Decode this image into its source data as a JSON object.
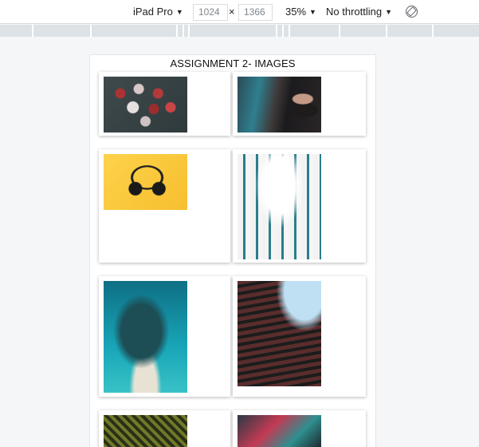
{
  "devtools": {
    "device": "iPad Pro",
    "width": "1024",
    "height": "1366",
    "separator": "×",
    "zoom": "35%",
    "throttling": "No throttling",
    "caret": "▼"
  },
  "page": {
    "title": "ASSIGNMENT 2- IMAGES"
  },
  "images": [
    {
      "name": "cupcakes-image"
    },
    {
      "name": "graffiti-image"
    },
    {
      "name": "headphones-image"
    },
    {
      "name": "building-image"
    },
    {
      "name": "reef-image"
    },
    {
      "name": "facade-image"
    },
    {
      "name": "palm-image"
    },
    {
      "name": "neon-image"
    }
  ],
  "colors": {
    "toolbar_bg": "#ffffff",
    "media_bar": "#dde2e6",
    "page_bg": "#f4f6f7"
  }
}
